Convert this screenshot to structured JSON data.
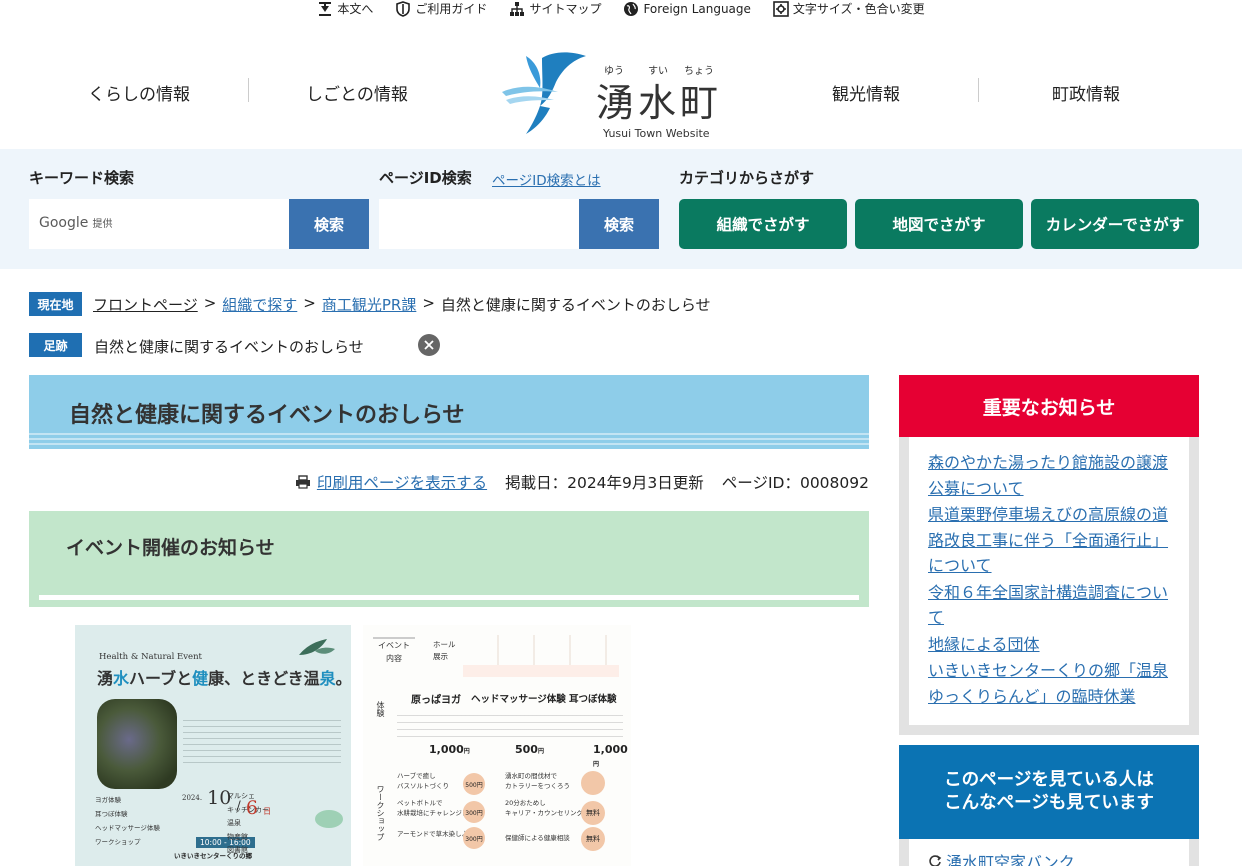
{
  "utility": {
    "skip": "本文へ",
    "guide": "ご利用ガイド",
    "sitemap": "サイトマップ",
    "foreign": "Foreign Language",
    "fontsize": "文字サイズ・色合い変更"
  },
  "nav": {
    "kurashi": "くらしの情報",
    "shigoto": "しごとの情報",
    "kanko": "観光情報",
    "chosei": "町政情報"
  },
  "logo": {
    "title": "湧水町",
    "ruby1": "ゆう",
    "ruby2": "すい",
    "ruby3": "ちょう",
    "subtitle": "Yusui Town Website"
  },
  "search": {
    "keyword_label": "キーワード検索",
    "google": "Google",
    "provided": "提供",
    "keyword_btn": "検索",
    "pageid_label": "ページID検索",
    "pageid_help": "ページID検索とは",
    "pageid_btn": "検索",
    "category_label": "カテゴリからさがす",
    "cat_org": "組織でさがす",
    "cat_map": "地図でさがす",
    "cat_calendar": "カレンダーでさがす"
  },
  "breadcrumb": {
    "tag": "現在地",
    "front": "フロントページ",
    "sep": ">",
    "org": "組織で探す",
    "dept": "商工観光PR課",
    "current": "自然と健康に関するイベントのおしらせ"
  },
  "trail": {
    "tag": "足跡",
    "item": "自然と健康に関するイベントのおしらせ"
  },
  "main": {
    "title": "自然と健康に関するイベントのおしらせ",
    "print": "印刷用ページを表示する",
    "posted": "掲載日：2024年9月3日更新",
    "page_id": "ページID：0008092",
    "section_title": "イベント開催のお知らせ"
  },
  "poster1": {
    "en": "Health & Natural Event",
    "title_a": "湧",
    "title_b": "水",
    "title_c": "ハーブと",
    "title_d": "健",
    "title_e": "康、ときどき温",
    "title_f": "泉",
    "title_g": "。",
    "year": "2024.",
    "date": "10",
    "slash": "/",
    "day": "6",
    "dow": "日",
    "time": "10:00 - 16:00",
    "venue": "いきいきセンターくりの郷",
    "list": [
      "ヨガ体験",
      "耳つぼ体験",
      "ヘッドマッサージ体験",
      "ワークショップ"
    ],
    "right_list": [
      "マルシェ",
      "キッチンカー",
      "温泉",
      "物産館",
      "図書館"
    ]
  },
  "poster2": {
    "event": "イベント\n内容",
    "hall": "ホール\n展示",
    "yoga": "原っぱヨガ",
    "head": "ヘッドマッサージ体験",
    "ear": "耳つぼ体験",
    "taiken": "体験",
    "ws": "ワークショップ",
    "price1": "1,000",
    "price2": "500",
    "price3": "1,000",
    "yen": "円",
    "w1": "ハーブで癒し\nバスソルトづくり",
    "w2": "ペットボトルで\n水耕栽培にチャレンジ！",
    "w3": "アーモンドで草木染しよう",
    "w4": "湧水町の間伐材で\nカトラリーをつくろう",
    "w5": "20分おためし\nキャリア・カウンセリング",
    "w6": "保健師による健康相談",
    "p500": "500円",
    "p300": "300円",
    "free": "無料"
  },
  "sidebar": {
    "important_title": "重要なお知らせ",
    "links": [
      "森のやかた湯ったり館施設の譲渡公募について",
      "県道栗野停車場えびの高原線の道路改良工事に伴う「全面通行止」について",
      "令和６年全国家計構造調査について",
      "地縁による団体",
      "いきいきセンターくりの郷「温泉ゆっくりらんど」の臨時休業"
    ],
    "related_title_1": "このページを見ている人は",
    "related_title_2": "こんなページも見ています",
    "related_link": "湧水町空家バンク"
  },
  "colors": {
    "brand_blue": "#1f6fb2",
    "category_green": "#0a7a60",
    "important_red": "#e60033",
    "title_bg": "#8ecde9",
    "section_bg": "#c2e6cb"
  }
}
